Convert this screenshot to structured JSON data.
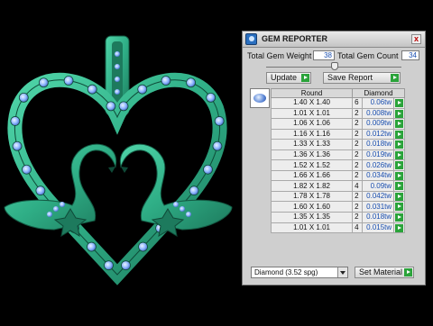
{
  "panel": {
    "title": "GEM REPORTER",
    "close_glyph": "x",
    "total_weight_label": "Total Gem Weight",
    "total_weight_value": "38",
    "total_count_label": "Total Gem Count",
    "total_count_value": "34",
    "update_label": "Update",
    "save_report_label": "Save Report",
    "table": {
      "headers": [
        "Round",
        "Diamond"
      ],
      "rows": [
        {
          "size": "1.40 X 1.40",
          "count": "6",
          "weight": "0.06tw"
        },
        {
          "size": "1.01 X 1.01",
          "count": "2",
          "weight": "0.008tw"
        },
        {
          "size": "1.06 X 1.06",
          "count": "2",
          "weight": "0.009tw"
        },
        {
          "size": "1.16 X 1.16",
          "count": "2",
          "weight": "0.012tw"
        },
        {
          "size": "1.33 X 1.33",
          "count": "2",
          "weight": "0.018tw"
        },
        {
          "size": "1.36 X 1.36",
          "count": "2",
          "weight": "0.019tw"
        },
        {
          "size": "1.52 X 1.52",
          "count": "2",
          "weight": "0.026tw"
        },
        {
          "size": "1.66 X 1.66",
          "count": "2",
          "weight": "0.034tw"
        },
        {
          "size": "1.82 X 1.82",
          "count": "4",
          "weight": "0.09tw"
        },
        {
          "size": "1.78 X 1.78",
          "count": "2",
          "weight": "0.042tw"
        },
        {
          "size": "1.60 X 1.60",
          "count": "2",
          "weight": "0.031tw"
        },
        {
          "size": "1.35 X 1.35",
          "count": "2",
          "weight": "0.018tw"
        },
        {
          "size": "1.01 X 1.01",
          "count": "4",
          "weight": "0.015tw"
        }
      ]
    },
    "material_select": "Diamond    (3.52 spg)",
    "set_material_label": "Set Material"
  },
  "colors": {
    "background": "#000000",
    "jewel_green": "#2fae86",
    "gem_blue": "#8fb7ff",
    "action_green": "#2aa33a"
  },
  "icons": [
    "app-gem-icon",
    "close-icon",
    "arrow-right-icon",
    "chevron-down-icon",
    "gem-preview-icon"
  ]
}
